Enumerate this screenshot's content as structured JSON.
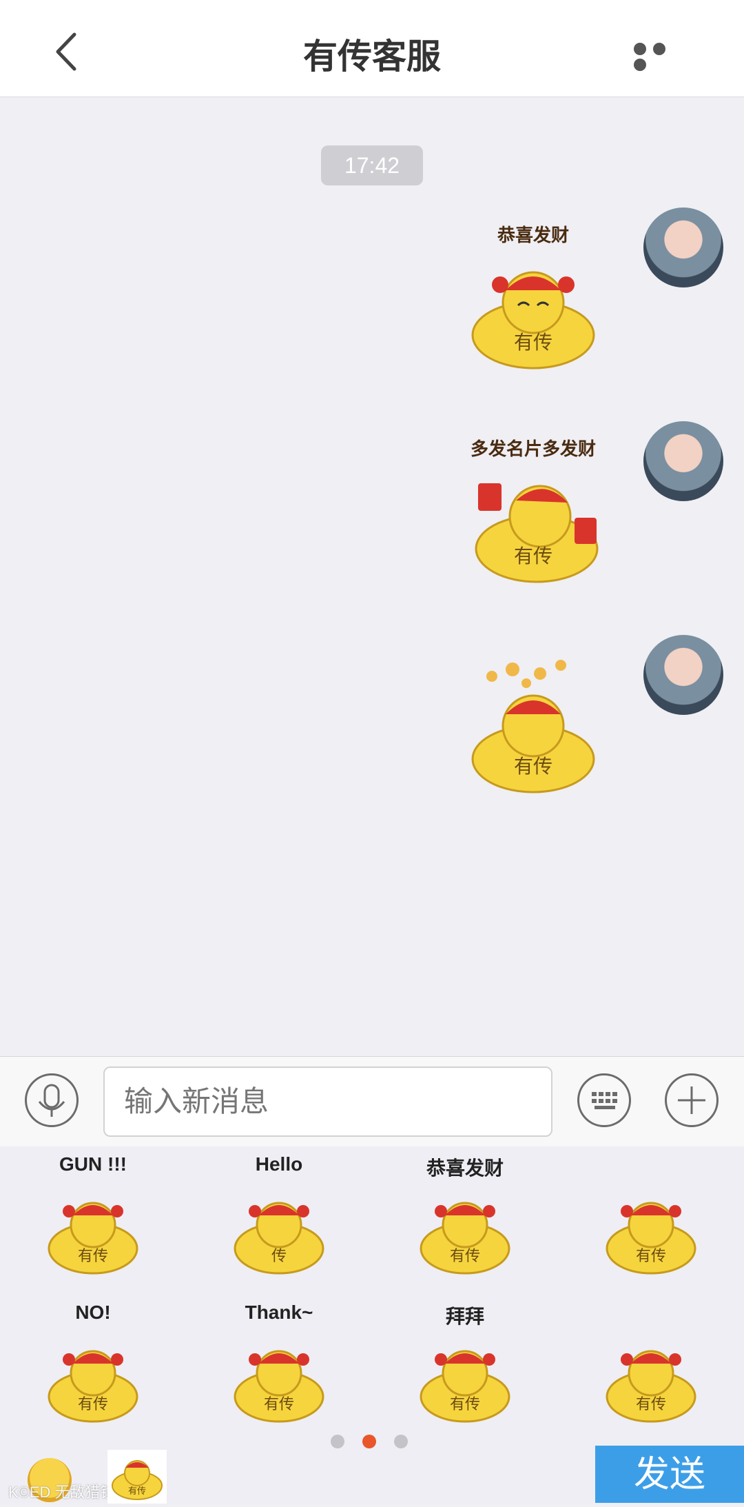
{
  "header": {
    "title": "有传客服"
  },
  "chat": {
    "timestamp": "17:42",
    "messages": [
      {
        "caption": "恭喜发财",
        "sticker_text": "有传"
      },
      {
        "caption": "多发名片多发财",
        "sticker_text": "有传"
      },
      {
        "caption": "",
        "sticker_text": "有传"
      }
    ]
  },
  "input": {
    "placeholder": "输入新消息"
  },
  "sticker_panel": {
    "items": [
      {
        "caption": "GUN !!!",
        "text": "有传"
      },
      {
        "caption": "Hello",
        "text": "传"
      },
      {
        "caption": "恭喜发财",
        "text": "有传"
      },
      {
        "caption": "",
        "text": "有传"
      },
      {
        "caption": "NO!",
        "text": "有传"
      },
      {
        "caption": "Thank~",
        "text": "有传"
      },
      {
        "caption": "拜拜",
        "text": "有传"
      },
      {
        "caption": "",
        "text": "有传"
      }
    ],
    "page_dots": {
      "count": 3,
      "active_index": 1
    },
    "tab_sticker_text": "有传",
    "watermark": "K©ED 无敌猎镜",
    "send_label": "发送"
  },
  "colors": {
    "send_button": "#3d9ee8",
    "active_dot": "#e8562a",
    "sticker_body": "#f6d43e",
    "hat": "#d9342b"
  }
}
